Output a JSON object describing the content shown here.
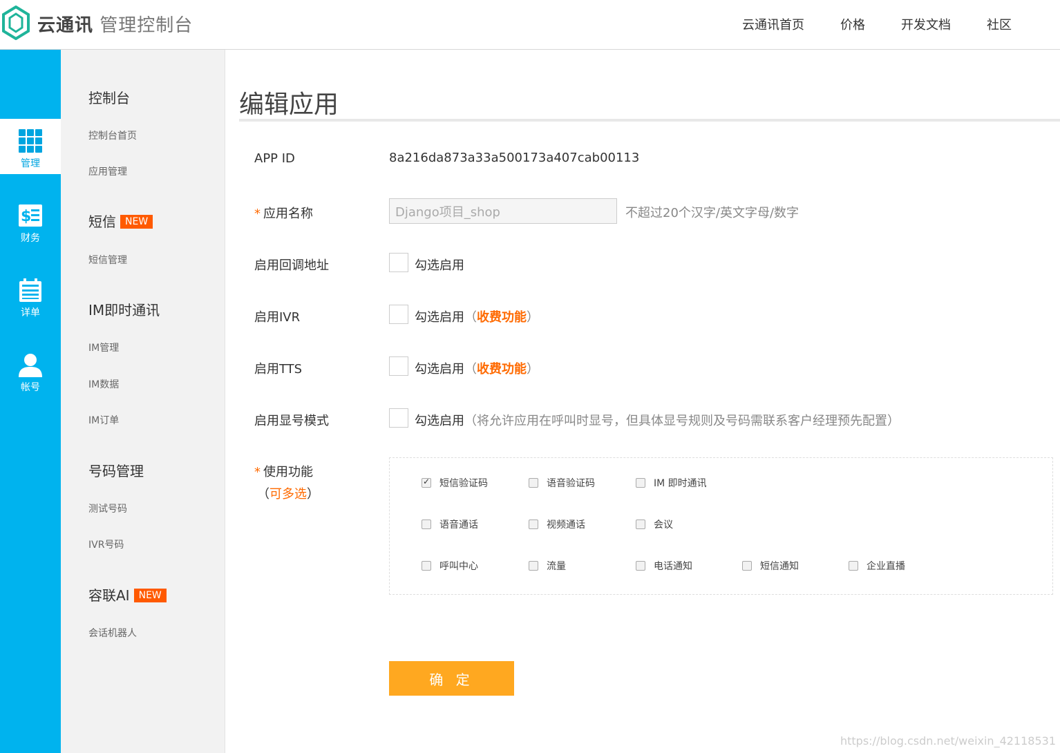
{
  "header": {
    "brand_strong": "云通讯",
    "brand_light": "管理控制台",
    "nav": [
      "云通讯首页",
      "价格",
      "开发文档",
      "社区"
    ]
  },
  "rail": [
    {
      "label": "管理",
      "icon": "grid-icon",
      "active": true
    },
    {
      "label": "财务",
      "icon": "finance-icon",
      "active": false
    },
    {
      "label": "详单",
      "icon": "calendar-list-icon",
      "active": false
    },
    {
      "label": "帐号",
      "icon": "user-icon",
      "active": false
    }
  ],
  "sidebar": {
    "console": {
      "title": "控制台",
      "items": [
        "控制台首页",
        "应用管理"
      ]
    },
    "sms": {
      "title": "短信",
      "badge": "NEW",
      "items": [
        "短信管理"
      ]
    },
    "im": {
      "title": "IM即时通讯",
      "items": [
        "IM管理",
        "IM数据",
        "IM订单"
      ]
    },
    "number": {
      "title": "号码管理",
      "items": [
        "测试号码",
        "IVR号码"
      ]
    },
    "ai": {
      "title": "容联AI",
      "badge": "NEW",
      "items": [
        "会话机器人"
      ]
    }
  },
  "page": {
    "title": "编辑应用"
  },
  "form": {
    "app_id_label": "APP ID",
    "app_id_value": "8a216da873a33a500173a407cab00113",
    "req_mark": "*",
    "name_label": "应用名称",
    "name_value": "Django项目_shop",
    "name_hint": "不超过20个汉字/英文字母/数字",
    "callback_label": "启用回调地址",
    "ivr_label": "启用IVR",
    "tts_label": "启用TTS",
    "display_label": "启用显号模式",
    "check_text": "勾选启用",
    "paid_open": "（",
    "paid_text": "收费功能",
    "paid_close": "）",
    "display_note": "（将允许应用在呼叫时显号，但具体显号规则及号码需联系客户经理预先配置）",
    "features_label": "使用功能",
    "features_open": "（",
    "features_multi": "可多选",
    "features_close": "）",
    "features": [
      {
        "label": "短信验证码",
        "checked": true
      },
      {
        "label": "语音验证码",
        "checked": false
      },
      {
        "label": "IM 即时通讯",
        "checked": false
      },
      {
        "label": "语音通话",
        "checked": false
      },
      {
        "label": "视频通话",
        "checked": false
      },
      {
        "label": "会议",
        "checked": false
      },
      {
        "label": "呼叫中心",
        "checked": false
      },
      {
        "label": "流量",
        "checked": false
      },
      {
        "label": "电话通知",
        "checked": false
      },
      {
        "label": "短信通知",
        "checked": false
      },
      {
        "label": "企业直播",
        "checked": false
      }
    ],
    "submit_label": "确 定"
  },
  "watermark": "https://blog.csdn.net/weixin_42118531",
  "colors": {
    "rail": "#00b3ee",
    "accent": "#ff6a00",
    "button": "#ffa820",
    "badge": "#ff5a00"
  }
}
